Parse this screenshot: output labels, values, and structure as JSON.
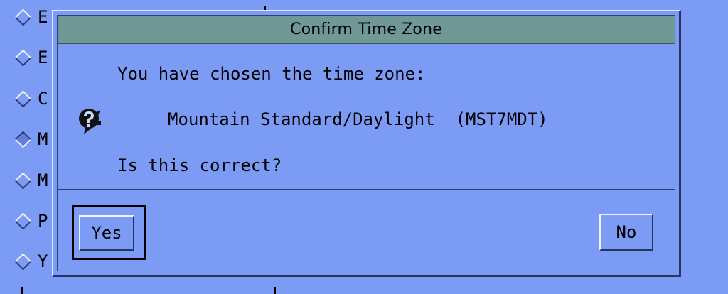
{
  "dialog": {
    "title": "Confirm Time Zone",
    "line1": "You have chosen the time zone:",
    "timezone": "Mountain Standard/Daylight  (MST7MDT)",
    "question": "Is this correct?",
    "icon": "question-icon",
    "buttons": {
      "yes": "Yes",
      "no": "No"
    }
  },
  "background_list": {
    "items": [
      {
        "label": "E",
        "selected": false
      },
      {
        "label": "E",
        "selected": false
      },
      {
        "label": "C",
        "selected": false
      },
      {
        "label": "M",
        "selected": true
      },
      {
        "label": "M",
        "selected": false
      },
      {
        "label": "P",
        "selected": false
      },
      {
        "label": "Y",
        "selected": false
      }
    ]
  },
  "colors": {
    "background": "#7b9bf5",
    "titlebar": "#6f9896"
  }
}
